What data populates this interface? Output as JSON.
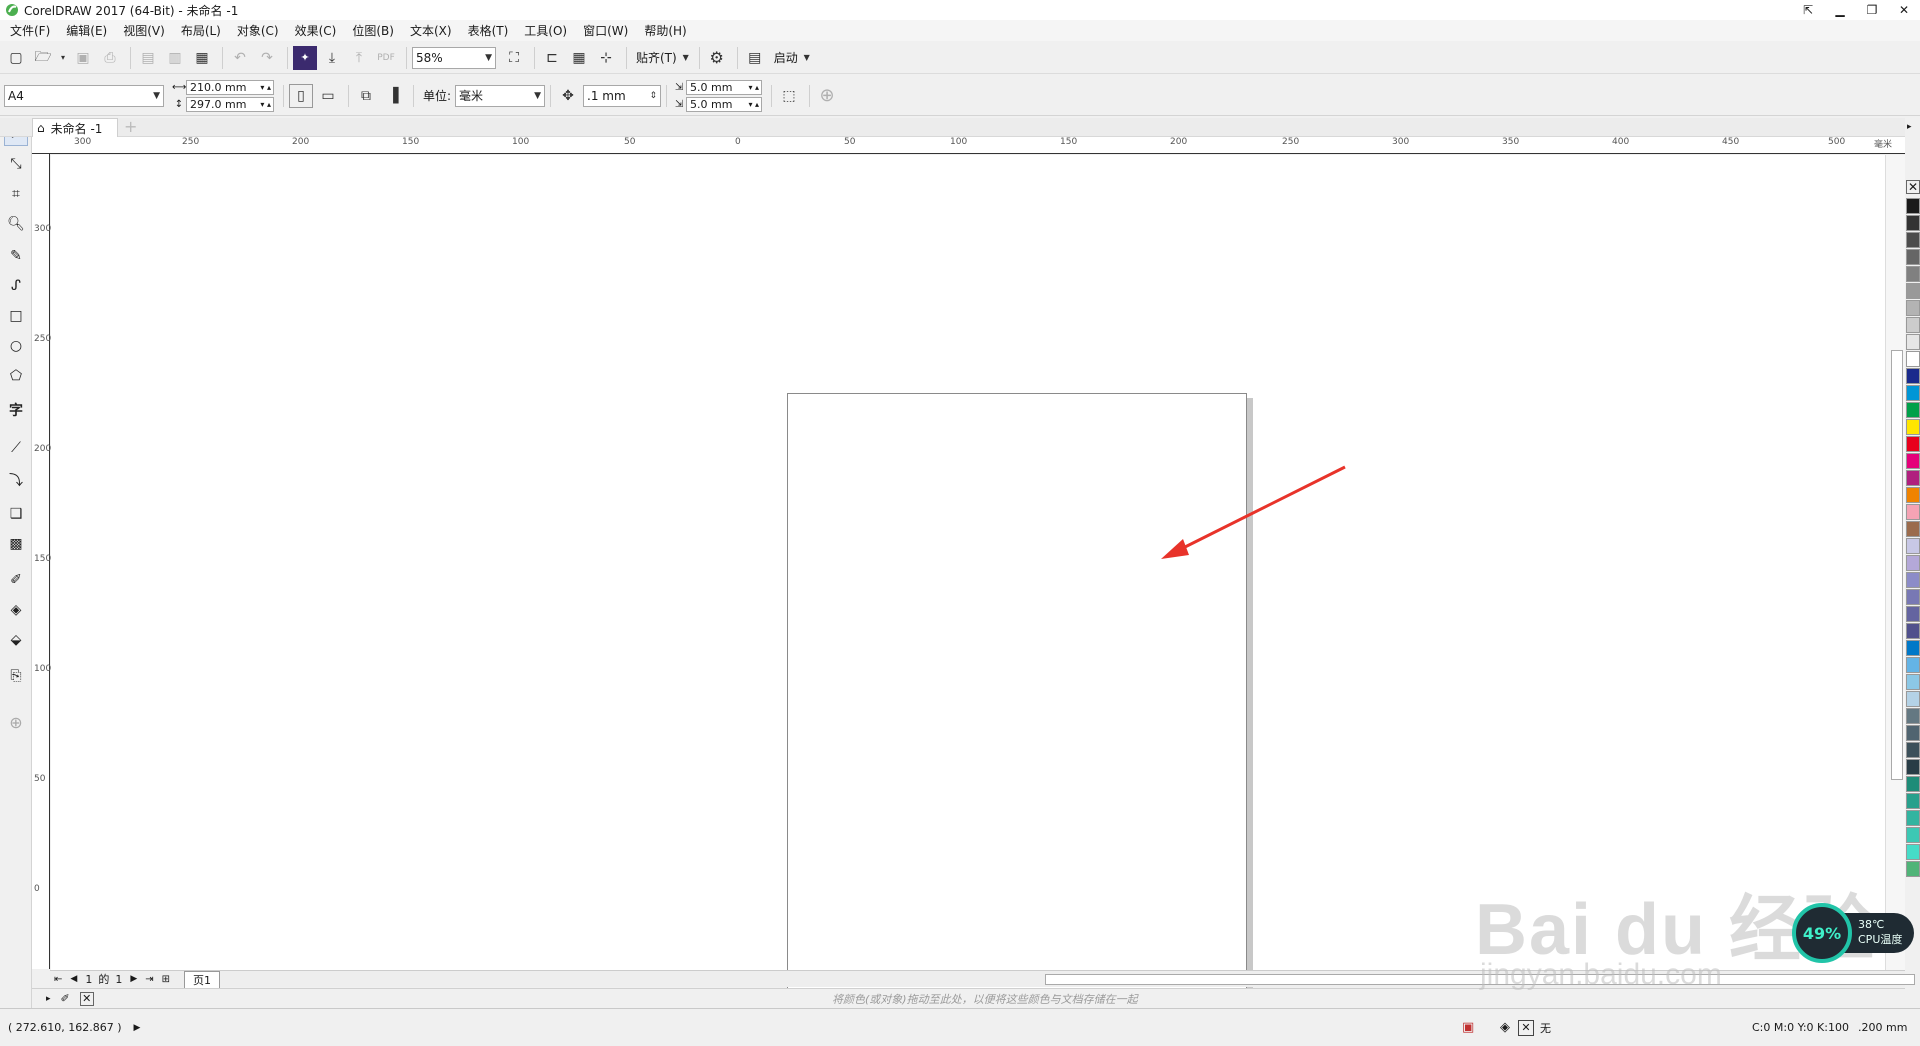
{
  "window": {
    "title": "CorelDRAW 2017 (64-Bit) - 未命名 -1",
    "controls": [
      "⇱",
      "▁",
      "❐",
      "✕"
    ]
  },
  "menu": [
    "文件(F)",
    "编辑(E)",
    "视图(V)",
    "布局(L)",
    "对象(C)",
    "效果(C)",
    "位图(B)",
    "文本(X)",
    "表格(T)",
    "工具(O)",
    "窗口(W)",
    "帮助(H)"
  ],
  "toolbar": {
    "zoom": "58%",
    "snap_label": "贴齐(T)",
    "launch_label": "启动"
  },
  "propbar": {
    "page_size": "A4",
    "width": "210.0 mm",
    "height": "297.0 mm",
    "units_label": "单位:",
    "units_value": "毫米",
    "nudge": ".1 mm",
    "dup_x": "5.0 mm",
    "dup_y": "5.0 mm"
  },
  "doc_tab": "未命名 -1",
  "ruler": {
    "h_ticks": [
      "300",
      "250",
      "200",
      "150",
      "100",
      "50",
      "0",
      "50",
      "100",
      "150",
      "200",
      "250",
      "300",
      "350",
      "400",
      "450",
      "500"
    ],
    "h_unit": "毫米",
    "v_ticks": [
      "300",
      "250",
      "200",
      "150",
      "100",
      "50",
      "0"
    ]
  },
  "pagenav": {
    "current": "1",
    "of": "的",
    "total": "1",
    "page_tab": "页1"
  },
  "hint": "将颜色(或对象)拖动至此处，以便将这些颜色与文档存储在一起",
  "status": {
    "coords": "( 272.610, 162.867 )",
    "fill_label": "无",
    "color_info": "C:0 M:0 Y:0 K:100",
    "outline": ".200 mm"
  },
  "cpu_widget": {
    "percent": "49%",
    "temp": "38℃",
    "label": "CPU温度"
  },
  "watermark": {
    "brand": "Bai du 经验",
    "url": "jingyan.baidu.com"
  },
  "palette": [
    "#1a1a1a",
    "#333333",
    "#4d4d4d",
    "#666666",
    "#808080",
    "#999999",
    "#b3b3b3",
    "#cccccc",
    "#e6e6e6",
    "#ffffff",
    "#1a2a8c",
    "#0096d6",
    "#00a04a",
    "#ffe600",
    "#e8001c",
    "#e5007a",
    "#b0207e",
    "#f08300",
    "#f5a3b4",
    "#9b6b4c",
    "#c8c8e6",
    "#b4a8d8",
    "#8c8cc8",
    "#7878b4",
    "#6464a0",
    "#50508c",
    "#0078c8",
    "#64b4e6",
    "#8cc8e6",
    "#b4d2e6",
    "#647882",
    "#506470",
    "#3c505a",
    "#283c46",
    "#1e8c78",
    "#28a08c",
    "#32b4a0",
    "#3cc8b4",
    "#46dcc8",
    "#50b478"
  ],
  "annotation": {
    "arrow_color": "#e8332a"
  }
}
